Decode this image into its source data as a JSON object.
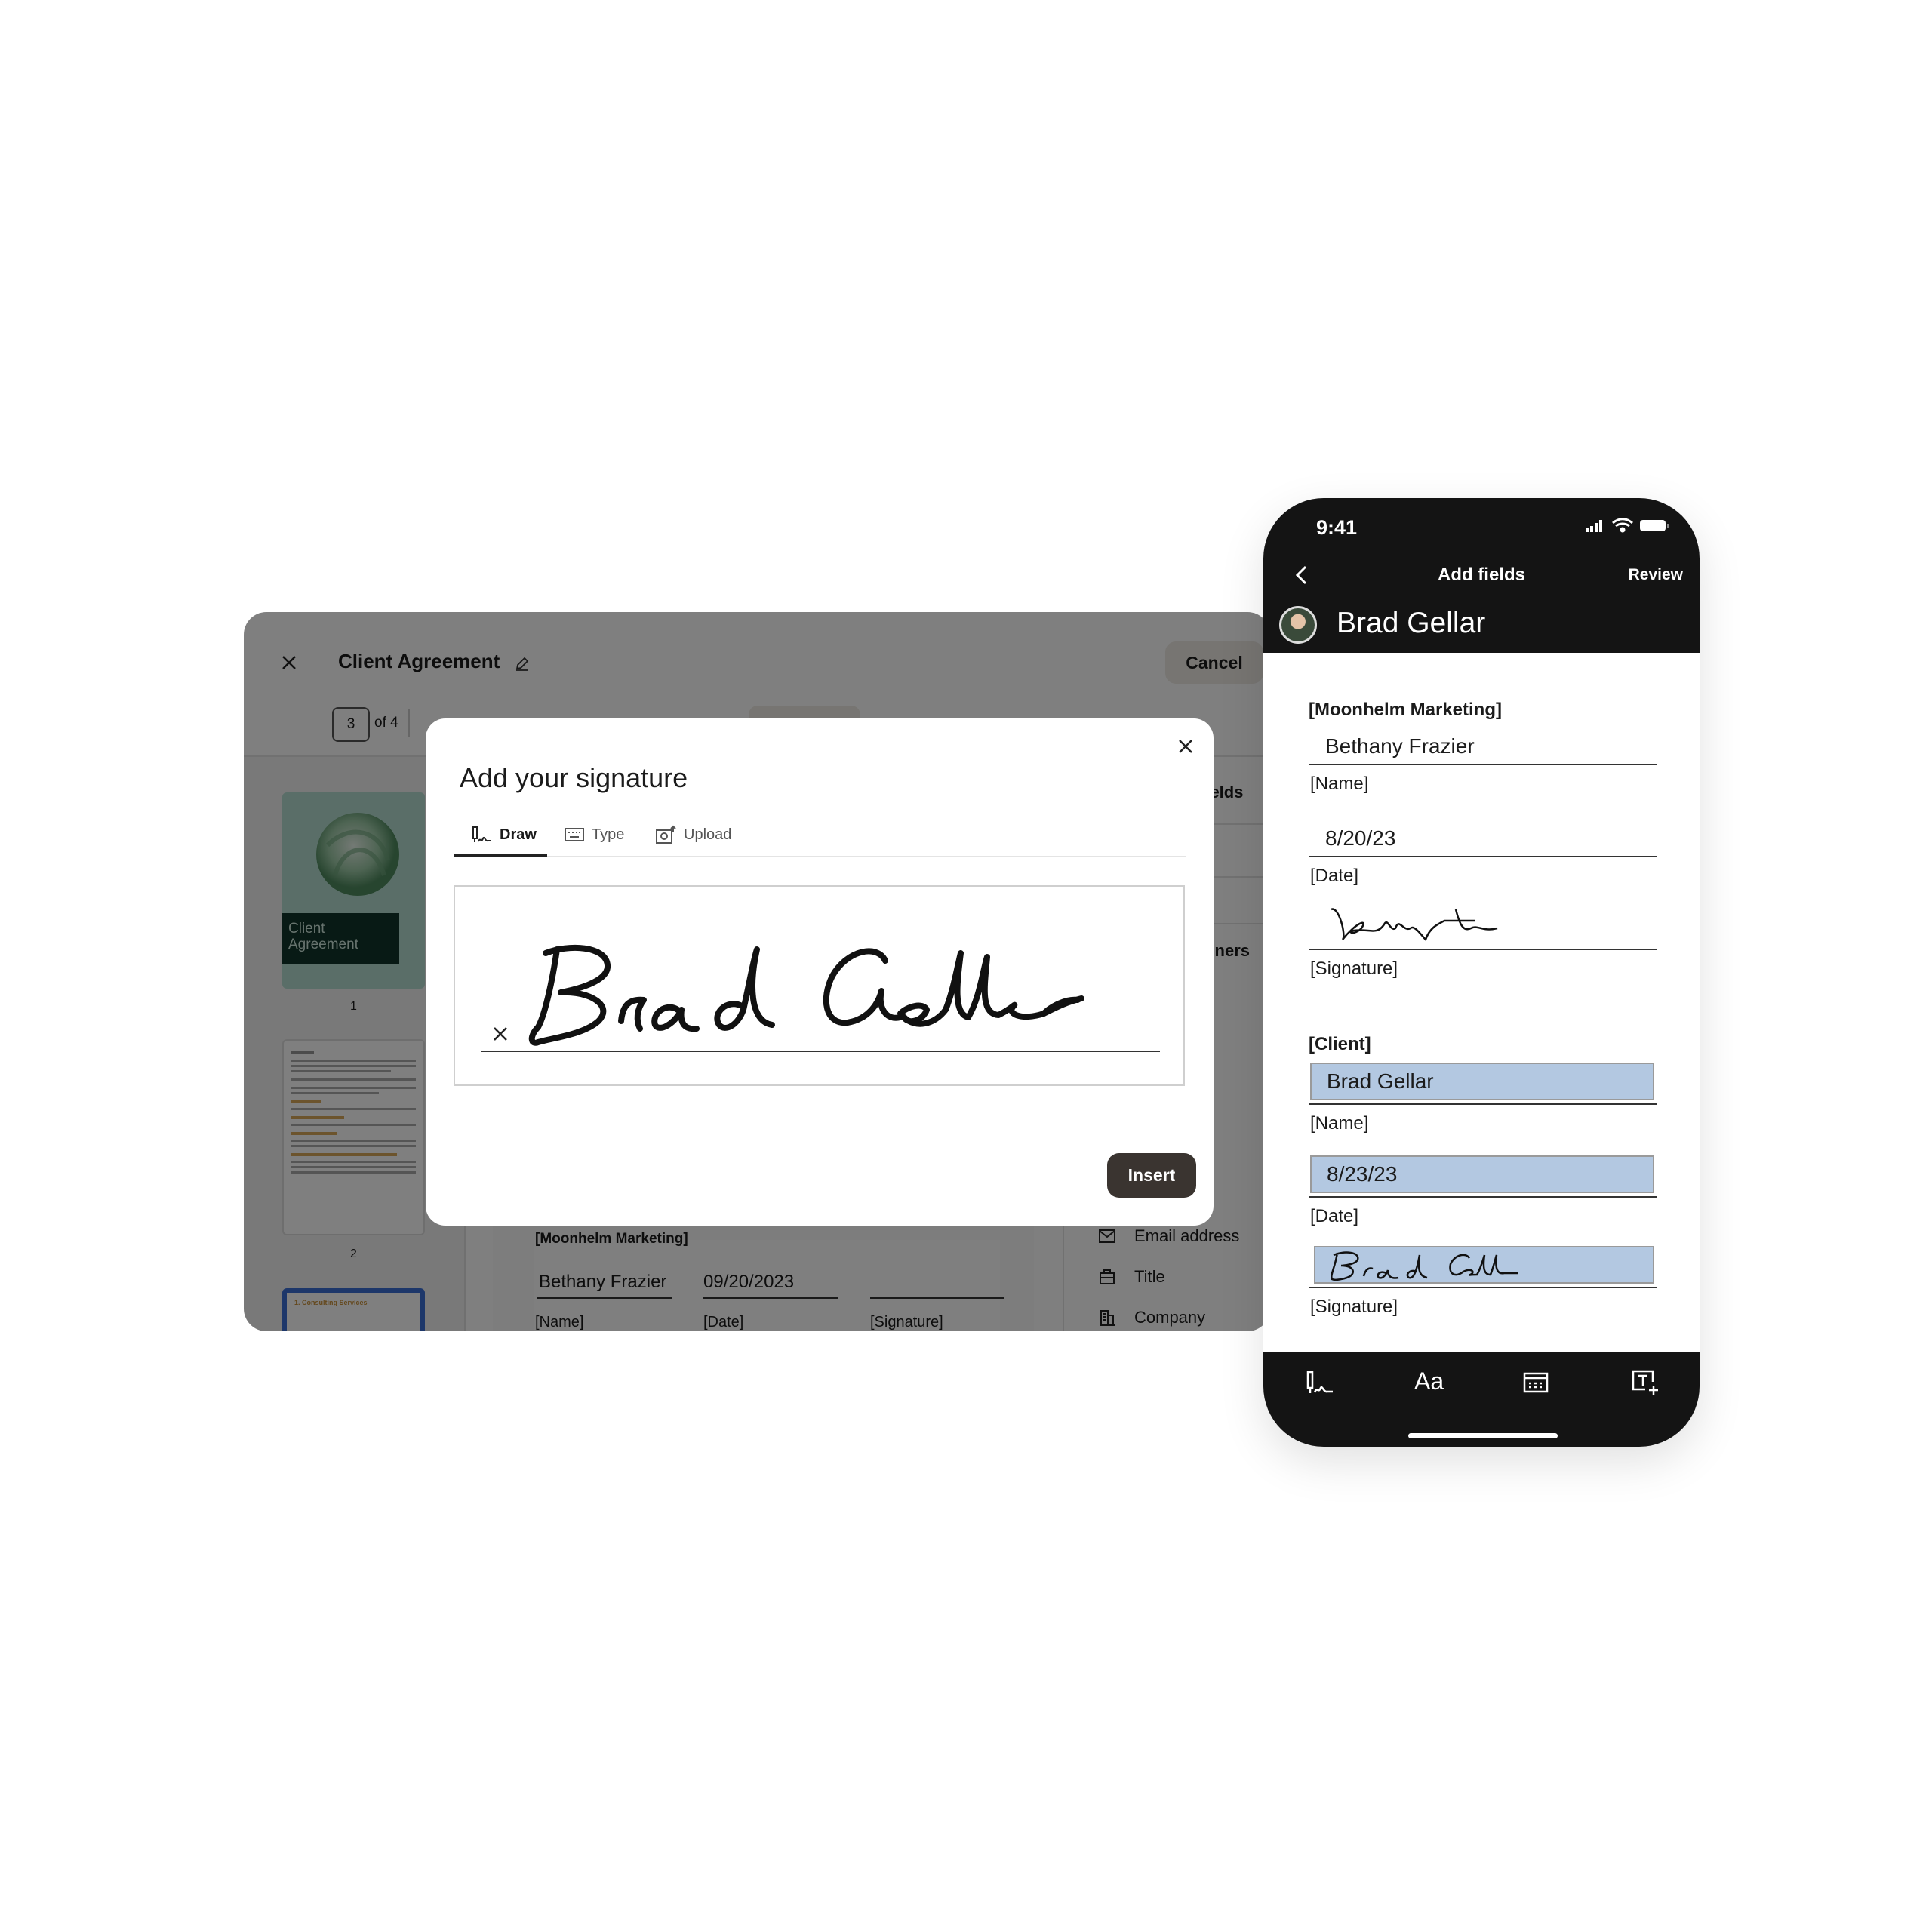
{
  "desktop": {
    "document_title": "Client Agreement",
    "cancel_label": "Cancel",
    "page_current": "3",
    "page_of": "of 4",
    "thumbnails": [
      {
        "label": "Client Agreement",
        "number": "1"
      },
      {
        "number": "2"
      },
      {
        "heading": "1. Consulting Services"
      }
    ],
    "document": {
      "section": "[Moonhelm Marketing]",
      "name_value": "Bethany Frazier",
      "date_value": "09/20/2023",
      "name_label": "[Name]",
      "date_label": "[Date]",
      "signature_label": "[Signature]"
    },
    "right_panel": {
      "partial_fields": "fields",
      "partial_signers": "igners",
      "partial_d": "d",
      "items": [
        {
          "label": "Email address",
          "icon": "envelope-icon"
        },
        {
          "label": "Title",
          "icon": "briefcase-icon"
        },
        {
          "label": "Company",
          "icon": "building-icon"
        }
      ]
    }
  },
  "modal": {
    "title": "Add your signature",
    "tabs": [
      {
        "label": "Draw",
        "icon": "pen-signature-icon",
        "active": true
      },
      {
        "label": "Type",
        "icon": "keyboard-icon",
        "active": false
      },
      {
        "label": "Upload",
        "icon": "camera-upload-icon",
        "active": false
      }
    ],
    "signature_text": "Brad Gellar",
    "insert_label": "Insert"
  },
  "phone": {
    "time": "9:41",
    "nav_title": "Add fields",
    "review_label": "Review",
    "signer_name": "Brad Gellar",
    "sections": [
      {
        "heading": "[Moonhelm Marketing]",
        "name_value": "Bethany Frazier",
        "name_label": "[Name]",
        "date_value": "8/20/23",
        "date_label": "[Date]",
        "signature_text": "Bethany Frazier",
        "signature_label": "[Signature]"
      },
      {
        "heading": "[Client]",
        "name_value": "Brad Gellar",
        "name_label": "[Name]",
        "date_value": "8/23/23",
        "date_label": "[Date]",
        "signature_text": "Brad Gellar",
        "signature_label": "[Signature]"
      }
    ],
    "toolbar": [
      "signature-icon",
      "text-icon",
      "date-icon",
      "add-text-field-icon"
    ]
  },
  "colors": {
    "field_highlight": "#b3c8e1",
    "insert_button": "#3a3430",
    "thumbnail_selected": "#3b6fd4",
    "accent_heading": "#c9913a"
  }
}
